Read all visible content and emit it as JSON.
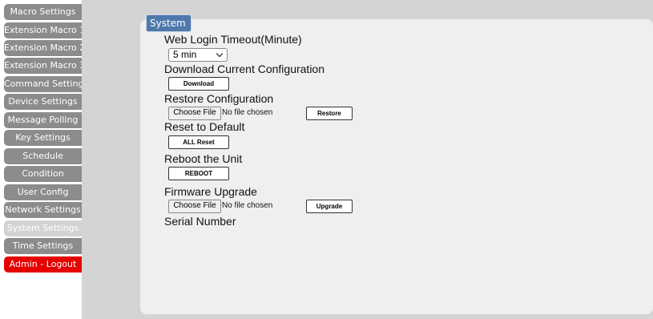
{
  "sidebar": {
    "items": [
      {
        "label": "Macro Settings"
      },
      {
        "label": "Extension Macro 1"
      },
      {
        "label": "Extension Macro 2"
      },
      {
        "label": "Extension Macro 3"
      },
      {
        "label": "Command Settings"
      },
      {
        "label": "Device Settings"
      },
      {
        "label": "Message Polling"
      },
      {
        "label": "Key Settings"
      },
      {
        "label": "Schedule"
      },
      {
        "label": "Condition"
      },
      {
        "label": "User Config"
      },
      {
        "label": "Network Settings"
      },
      {
        "label": "System Settings",
        "active": true
      },
      {
        "label": "Time Settings"
      },
      {
        "label": "Admin - Logout"
      }
    ]
  },
  "panel": {
    "title": "System",
    "login_timeout": {
      "label": "Web Login Timeout(Minute)",
      "selected": "5 min"
    },
    "download_config": {
      "label": "Download Current Configuration",
      "button": "Download"
    },
    "restore_config": {
      "label": "Restore Configuration",
      "choose_file": "Choose File",
      "file_status": "No file chosen",
      "button": "Restore"
    },
    "reset_default": {
      "label": "Reset to Default",
      "button": "ALL Reset"
    },
    "reboot": {
      "label": "Reboot the Unit",
      "button": "REBOOT"
    },
    "firmware": {
      "label": "Firmware Upgrade",
      "choose_file": "Choose File",
      "file_status": "No file chosen",
      "button": "Upgrade"
    },
    "serial_number": {
      "label": "Serial Number"
    }
  },
  "colors": {
    "nav_inactive": "#8c8c8c",
    "nav_active": "#d3d3d3",
    "nav_logout": "#e60000",
    "title_tab": "#4f78ad",
    "panel_bg": "#efefef",
    "page_bg": "#d4d4d4"
  }
}
